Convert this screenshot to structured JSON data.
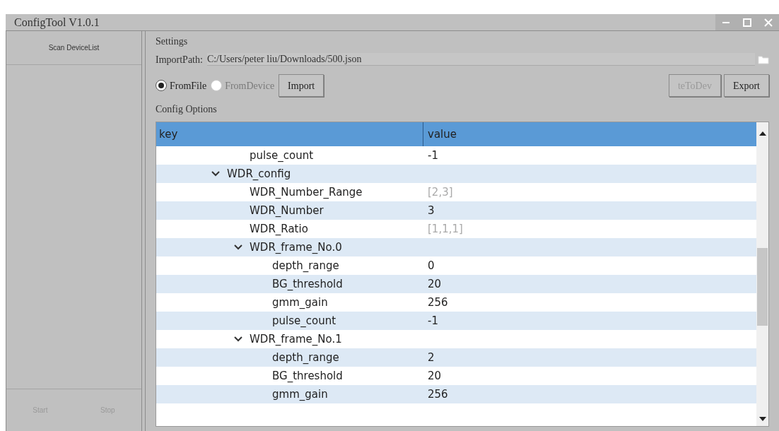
{
  "window": {
    "title": "ConfigTool V1.0.1"
  },
  "sidebar": {
    "scan_button": "Scan DeviceList",
    "start_button": {
      "label": "Start",
      "disabled": true
    },
    "stop_button": {
      "label": "Stop",
      "disabled": true
    }
  },
  "settings": {
    "title": "Settings",
    "import_path_label": "ImportPath:",
    "import_path": "C:/Users/peter liu/Downloads/500.json",
    "sources": [
      {
        "label": "FromFile",
        "selected": true,
        "disabled": false
      },
      {
        "label": "FromDevice",
        "selected": false,
        "disabled": true
      }
    ],
    "import_button": {
      "label": "Import",
      "disabled": false
    },
    "write_button": {
      "label": "teToDev",
      "disabled": true
    },
    "export_button": {
      "label": "Export",
      "disabled": false
    }
  },
  "config": {
    "title": "Config Options",
    "columns": [
      "key",
      "value"
    ],
    "leading_rows": [
      {
        "key": "pulse_count",
        "value": "-1",
        "readonly": false
      }
    ],
    "rows": [
      {
        "key": "WDR_config",
        "expanded": true,
        "children": [
          {
            "key": "WDR_Number_Range",
            "value": "[2,3]",
            "readonly": true
          },
          {
            "key": "WDR_Number",
            "value": "3",
            "readonly": false
          },
          {
            "key": "WDR_Ratio",
            "value": "[1,1,1]",
            "readonly": true
          },
          {
            "key": "WDR_frame_No.0",
            "expanded": true,
            "children": [
              {
                "key": "depth_range",
                "value": "0",
                "readonly": false
              },
              {
                "key": "BG_threshold",
                "value": "20",
                "readonly": false
              },
              {
                "key": "gmm_gain",
                "value": "256",
                "readonly": false
              },
              {
                "key": "pulse_count",
                "value": "-1",
                "readonly": false
              }
            ]
          },
          {
            "key": "WDR_frame_No.1",
            "expanded": true,
            "children": [
              {
                "key": "depth_range",
                "value": "2",
                "readonly": false
              },
              {
                "key": "BG_threshold",
                "value": "20",
                "readonly": false
              },
              {
                "key": "gmm_gain",
                "value": "256",
                "readonly": false
              }
            ]
          }
        ]
      }
    ]
  }
}
